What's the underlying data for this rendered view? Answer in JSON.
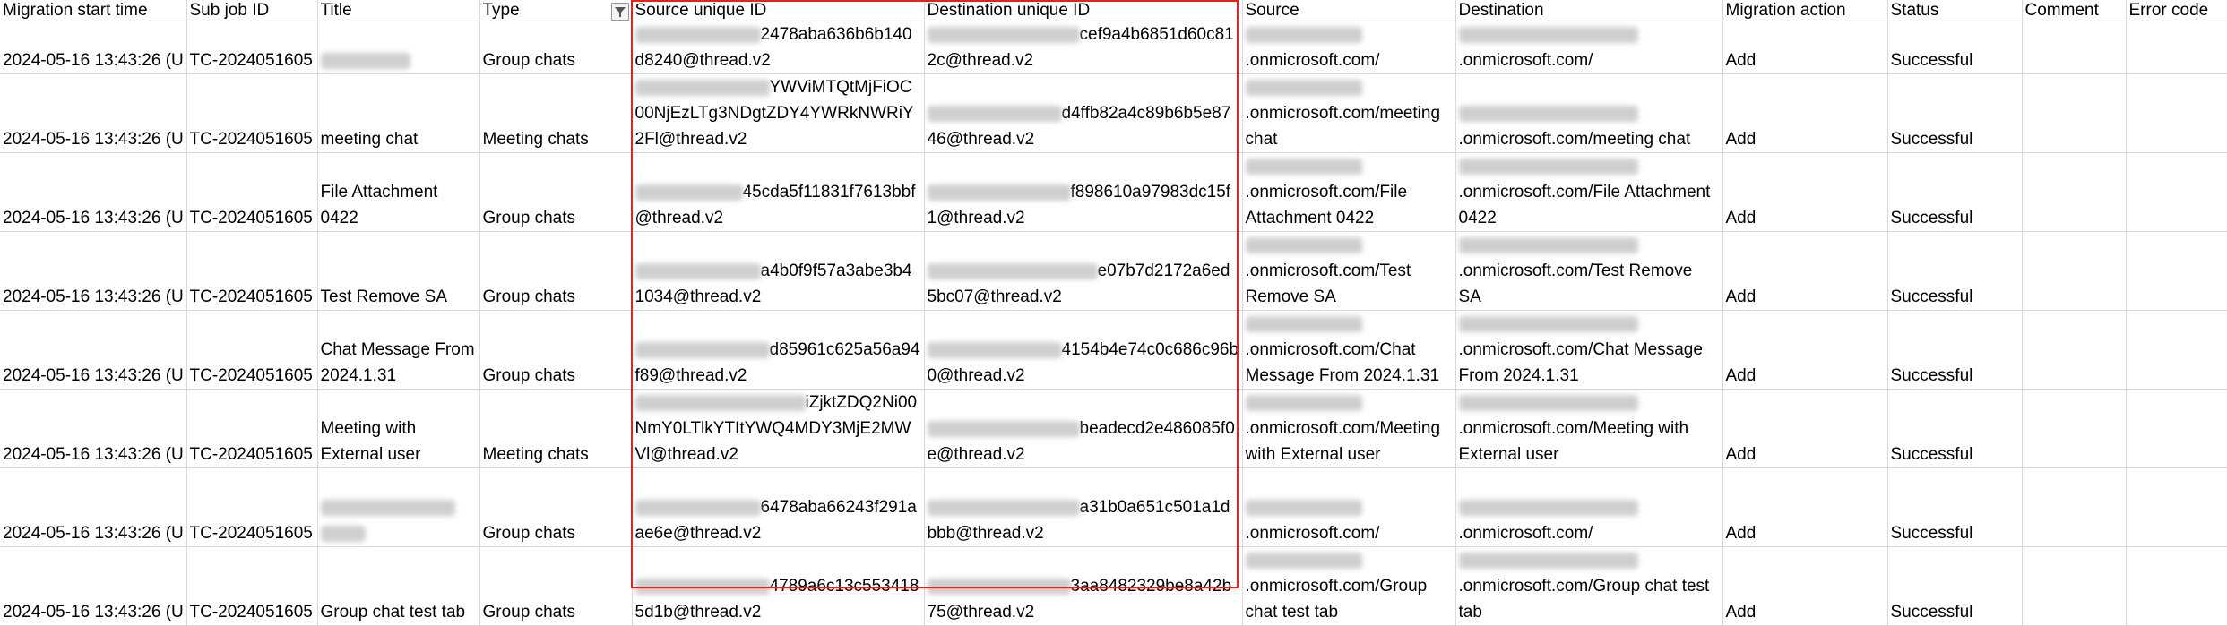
{
  "headers": [
    "Migration start time",
    "Sub job ID",
    "Title",
    "Type",
    "Source unique ID",
    "Destination unique ID",
    "Source",
    "Destination",
    "Migration action",
    "Status",
    "Comment",
    "Error code"
  ],
  "rows": [
    {
      "start": "2024-05-16 13:43:26 (U",
      "subjob": "TC-2024051605",
      "title": "",
      "type": "Group chats",
      "src_id": "2478aba636b6b140d8240@thread.v2",
      "dst_id": "cef9a4b6851d60c812c@thread.v2",
      "source": ".onmicrosoft.com/",
      "destination": ".onmicrosoft.com/",
      "action": "Add",
      "status": "Successful"
    },
    {
      "start": "2024-05-16 13:43:26 (U",
      "subjob": "TC-2024051605",
      "title": "meeting chat",
      "type": "Meeting chats",
      "src_id": "YWViMTQtMjFiOC00NjEzLTg3NDgtZDY4YWRkNWRiY2Fl@thread.v2",
      "dst_id": "d4ffb82a4c89b6b5e8746@thread.v2",
      "source": ".onmicrosoft.com/meeting chat",
      "destination": ".onmicrosoft.com/meeting chat",
      "action": "Add",
      "status": "Successful"
    },
    {
      "start": "2024-05-16 13:43:26 (U",
      "subjob": "TC-2024051605",
      "title": "File Attachment 0422",
      "type": "Group chats",
      "src_id": "45cda5f11831f7613bbf@thread.v2",
      "dst_id": "f898610a97983dc15f1@thread.v2",
      "source": ".onmicrosoft.com/File Attachment 0422",
      "destination": ".onmicrosoft.com/File Attachment 0422",
      "action": "Add",
      "status": "Successful"
    },
    {
      "start": "2024-05-16 13:43:26 (U",
      "subjob": "TC-2024051605",
      "title": "Test Remove SA",
      "type": "Group chats",
      "src_id": "a4b0f9f57a3abe3b41034@thread.v2",
      "dst_id": "e07b7d2172a6ed5bc07@thread.v2",
      "source": ".onmicrosoft.com/Test Remove SA",
      "destination": ".onmicrosoft.com/Test Remove SA",
      "action": "Add",
      "status": "Successful"
    },
    {
      "start": "2024-05-16 13:43:26 (U",
      "subjob": "TC-2024051605",
      "title": "Chat Message From 2024.1.31",
      "type": "Group chats",
      "src_id": "d85961c625a56a94f89@thread.v2",
      "dst_id": "4154b4e74c0c686c96b0@thread.v2",
      "source": ".onmicrosoft.com/Chat Message From 2024.1.31",
      "destination": ".onmicrosoft.com/Chat Message From 2024.1.31",
      "action": "Add",
      "status": "Successful"
    },
    {
      "start": "2024-05-16 13:43:26 (U",
      "subjob": "TC-2024051605",
      "title": "Meeting with External user",
      "type": "Meeting chats",
      "src_id": "iZjktZDQ2Ni00NmY0LTlkYTItYWQ4MDY3MjE2MWVl@thread.v2",
      "dst_id": "beadecd2e486085f0e@thread.v2",
      "source": ".onmicrosoft.com/Meeting with External user",
      "destination": ".onmicrosoft.com/Meeting with External user",
      "action": "Add",
      "status": "Successful"
    },
    {
      "start": "2024-05-16 13:43:26 (U",
      "subjob": "TC-2024051605",
      "title": "",
      "type": "Group chats",
      "src_id": "6478aba66243f291aae6e@thread.v2",
      "dst_id": "a31b0a651c501a1dbbb@thread.v2",
      "source": ".onmicrosoft.com/",
      "destination": ".onmicrosoft.com/",
      "action": "Add",
      "status": "Successful"
    },
    {
      "start": "2024-05-16 13:43:26 (U",
      "subjob": "TC-2024051605",
      "title": "Group chat test tab",
      "type": "Group chats",
      "src_id": "4789a6c13c5534185d1b@thread.v2",
      "dst_id": "3aa8482329be8a42b75@thread.v2",
      "source": ".onmicrosoft.com/Group chat test tab",
      "destination": ".onmicrosoft.com/Group chat test tab",
      "action": "Add",
      "status": "Successful"
    }
  ]
}
